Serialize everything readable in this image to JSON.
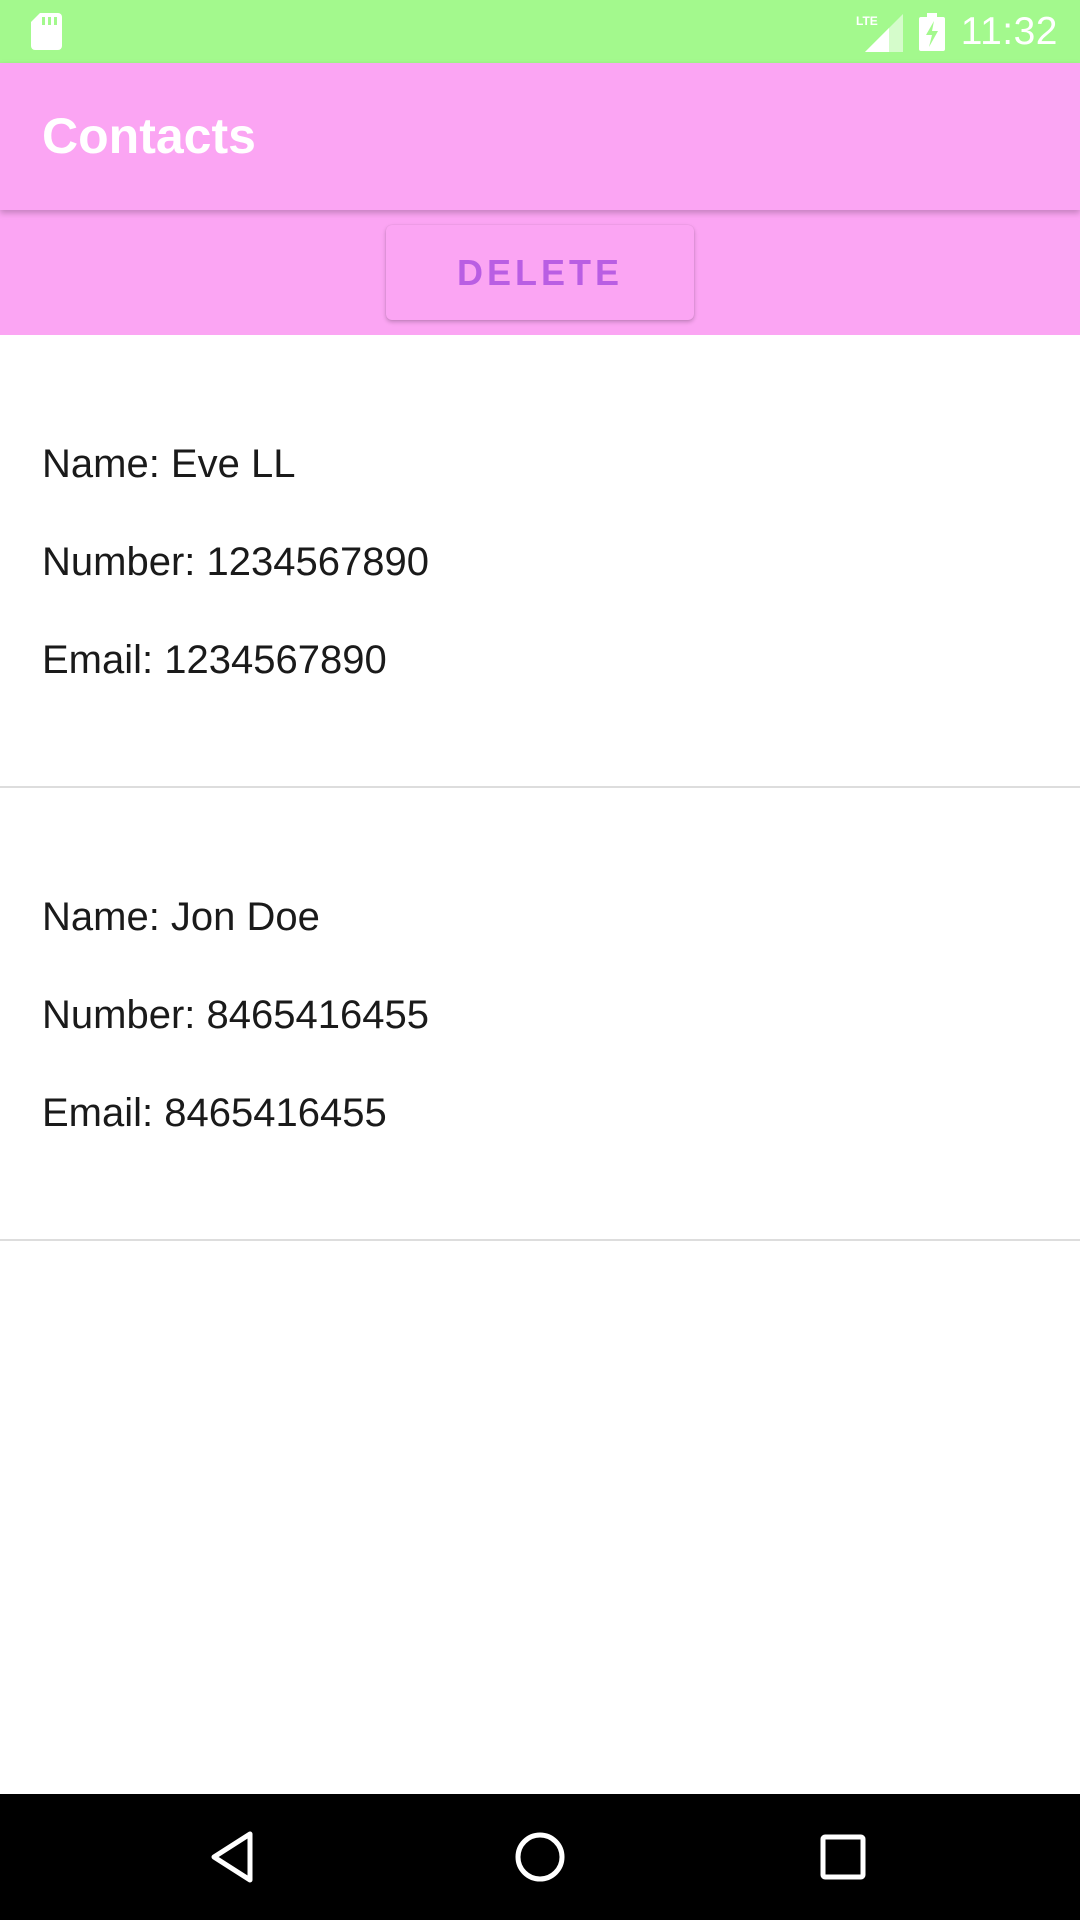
{
  "status_bar": {
    "time": "11:32",
    "bg_color": "#a3f98d",
    "icons": [
      "sd-card-icon",
      "lte-signal-icon",
      "battery-charging-icon"
    ]
  },
  "app_bar": {
    "title": "Contacts",
    "bg_color": "#fba5f3"
  },
  "actions": {
    "delete_label": "DELETE",
    "label_color": "#b95ee3"
  },
  "contacts": [
    {
      "name": "Name: Eve LL",
      "number": "Number: 1234567890",
      "email": "Email: 1234567890"
    },
    {
      "name": "Name: Jon Doe",
      "number": "Number: 8465416455",
      "email": "Email: 8465416455"
    }
  ],
  "nav_bar": {
    "icons": [
      "back-icon",
      "home-icon",
      "recents-icon"
    ]
  }
}
